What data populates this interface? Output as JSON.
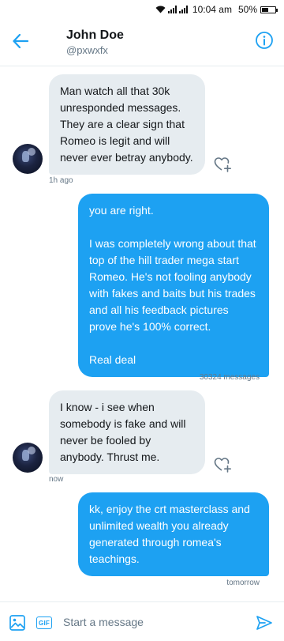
{
  "status_bar": {
    "time": "10:04 am",
    "battery": "50%",
    "battery_level": 0.5
  },
  "header": {
    "name": "John Doe",
    "handle": "@pxwxfx"
  },
  "messages": [
    {
      "direction": "incoming",
      "text": "Man watch all that 30k unresponded messages. They are a clear sign that Romeo is legit and will never ever betray anybody.",
      "meta": "1h ago"
    },
    {
      "direction": "outgoing",
      "text": "you are right.\n\nI was completely wrong about that top of the hill trader mega start Romeo. He's not fooling anybody with fakes and baits but his trades and all his feedback pictures prove he's 100% correct.\n\nReal deal",
      "meta": "30324 messages"
    },
    {
      "direction": "incoming",
      "text": "I know - i see when somebody is fake and will never be fooled by anybody. Thrust me.",
      "meta": "now"
    },
    {
      "direction": "outgoing",
      "text": "kk, enjoy the crt masterclass and unlimited wealth you already generated through romea's teachings.",
      "meta": "tomorrow"
    }
  ],
  "composer": {
    "gif_label": "GIF",
    "placeholder": "Start a message"
  },
  "colors": {
    "accent": "#1da1f2",
    "incoming_bubble": "#e6ecf0",
    "secondary_text": "#657786"
  },
  "icons": {
    "back": "arrow-left-icon",
    "info": "info-circle-icon",
    "like": "heart-plus-icon",
    "image": "image-icon",
    "send": "send-icon"
  }
}
